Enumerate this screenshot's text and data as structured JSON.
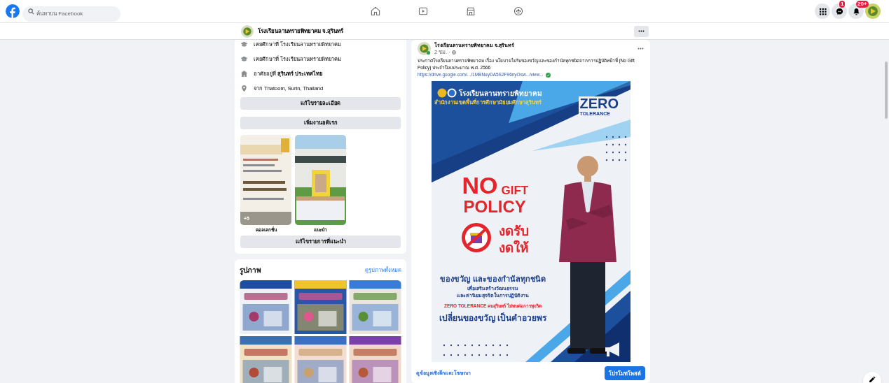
{
  "topbar": {
    "search": {
      "placeholder": "ค้นหาบน Facebook"
    },
    "badges": {
      "messenger": "1",
      "notifications": "20+"
    }
  },
  "page_header": {
    "name": "โรงเรียนลานทรายพิทยาคม จ.สุรินทร์"
  },
  "intro": {
    "details": [
      {
        "kind": "education",
        "text": "เคยศึกษาที่ โรงเรียนลานทรายพิทยาคม"
      },
      {
        "kind": "education",
        "text": "เคยศึกษาที่ โรงเรียนลานทรายพิทยาคม"
      },
      {
        "kind": "home",
        "text": "อาศัยอยู่ที่ **สุรินทร์ ประเทศไทย**"
      },
      {
        "kind": "from",
        "text": "จาก Thatoom, Surin, Thailand"
      }
    ],
    "edit_details": "แก้ไขรายละเอียด",
    "add_hobbies": "เพิ่มงานอดิเรก",
    "featured": [
      {
        "caption": "คอลเลกชั่น",
        "count": "+5"
      },
      {
        "caption": "แนะนำ"
      }
    ],
    "edit_featured": "แก้ไขรายการที่แนะนำ"
  },
  "photos": {
    "title": "รูปภาพ",
    "see_all": "ดูรูปภาพทั้งหมด"
  },
  "post": {
    "author": "โรงเรียนลานทรายพิทยาคม จ.สุรินทร์",
    "time": "2 ชม. ·",
    "text": "ประกาศโรงเรียนลานทรายพิทยาคม เรื่อง นโยบายไม่รับของขวัญและของกำนัลทุกชนิดจากการปฏิบัติหน้าที่ (No Gift Policy) ประจำปีงบประมาณ พ.ศ. 2566",
    "link": "https://drive.google.com/.../1MBNuyDA5S2F96nyOsw.../view...",
    "poster": {
      "school": "โรงเรียนลานทรายพิทยาคม",
      "office": "สำนักงานเขตพื้นที่การศึกษามัธยมศึกษาสุรินทร์",
      "zero": "ZERO",
      "tolerance": "TOLERANCE",
      "no": "NO",
      "gift": "GIFT",
      "policy": "POLICY",
      "refuse_give": "งดรับ",
      "refuse_take": "งดให้",
      "line1": "ของขวัญ และของกำนัลทุกชนิด",
      "line2": "เพื่อเสริมสร้างวัฒนธรรม",
      "line3": "และค่านิยมสุจริตในการปฏิบัติงาน",
      "line4": "ZERO TOLERANCE คนสุรินทร์ ไม่ทนต่อการทุจริต",
      "line5": "เปลี่ยนของขวัญ เป็นคำอวยพร"
    },
    "insights": "ดูข้อมูลเชิงลึกและโฆษณา",
    "promote": "โปรโมทโพสต์"
  }
}
